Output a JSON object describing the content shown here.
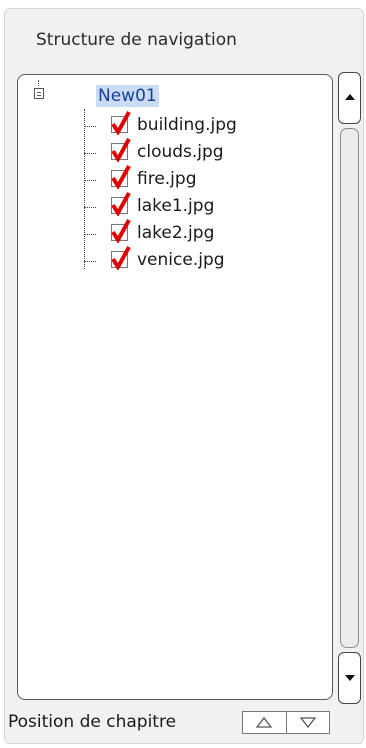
{
  "panel": {
    "title": "Structure de navigation"
  },
  "tree": {
    "root": {
      "label": "New01",
      "icon": "chapter-icon"
    },
    "items": [
      {
        "label": "building.jpg",
        "checked": true
      },
      {
        "label": "clouds.jpg",
        "checked": true
      },
      {
        "label": "fire.jpg",
        "checked": true
      },
      {
        "label": "lake1.jpg",
        "checked": true
      },
      {
        "label": "lake2.jpg",
        "checked": true
      },
      {
        "label": "venice.jpg",
        "checked": true
      }
    ]
  },
  "scrollbar": {
    "up_icon": "arrow-up-icon",
    "down_icon": "arrow-down-icon"
  },
  "footer": {
    "label": "Position de chapitre",
    "up_icon": "triangle-up-icon",
    "down_icon": "triangle-down-icon"
  },
  "colors": {
    "selection": "#c9dcf4",
    "selection_text": "#1a3f9a",
    "check": "#e00000"
  }
}
